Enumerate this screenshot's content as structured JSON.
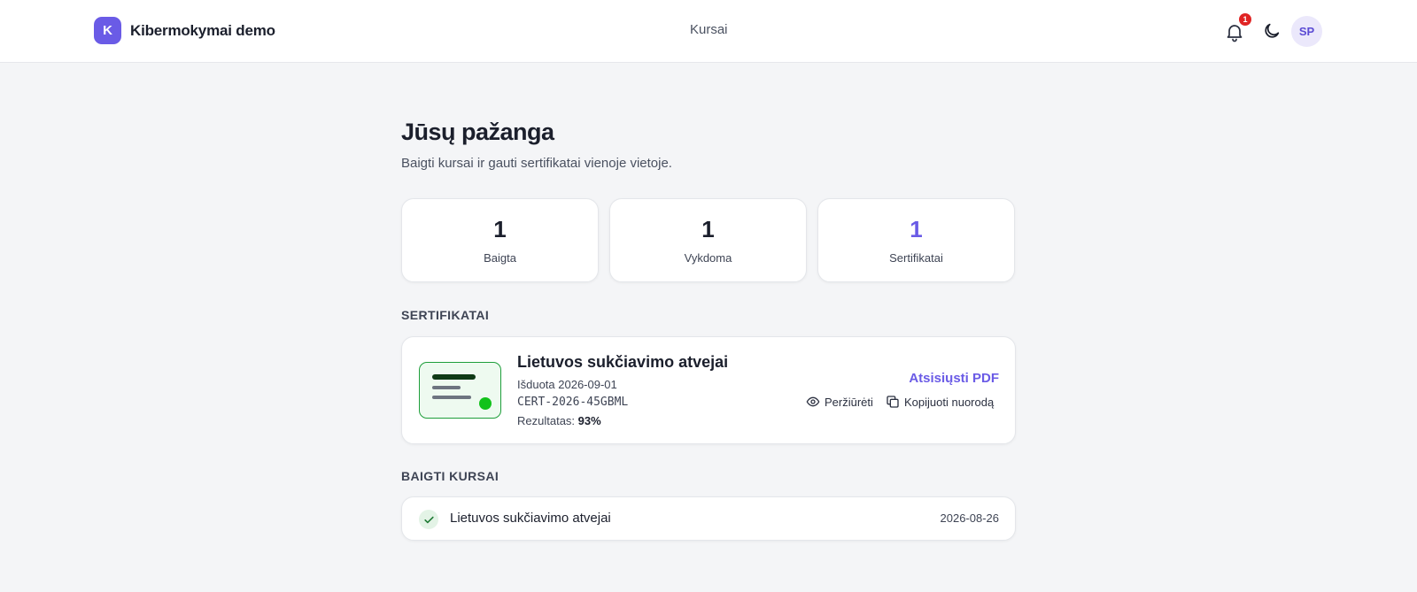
{
  "header": {
    "brand_initial": "K",
    "brand_name": "Kibermokymai demo",
    "nav_link": "Kursai",
    "notification_count": "1",
    "avatar_initials": "SP"
  },
  "page": {
    "title": "Jūsų pažanga",
    "subtitle": "Baigti kursai ir gauti sertifikatai vienoje vietoje."
  },
  "stats": [
    {
      "value": "1",
      "label": "Baigta"
    },
    {
      "value": "1",
      "label": "Vykdoma"
    },
    {
      "value": "1",
      "label": "Sertifikatai"
    }
  ],
  "certificates": {
    "section_label": "SERTIFIKATAI",
    "item": {
      "title": "Lietuvos sukčiavimo atvejai",
      "issued": "Išduota 2026-09-01",
      "code": "CERT-2026-45GBML",
      "score_label": "Rezultatas:",
      "score_value": "93%",
      "download_label": "Atsisiųsti PDF",
      "view_label": "Peržiūrėti",
      "copy_label": "Kopijuoti nuorodą"
    }
  },
  "completed": {
    "section_label": "BAIGTI KURSAI",
    "item": {
      "name": "Lietuvos sukčiavimo atvejai",
      "date": "2026-08-26"
    }
  },
  "colors": {
    "accent": "#6a5be6",
    "notification": "#e02424",
    "success": "#11c21a"
  }
}
